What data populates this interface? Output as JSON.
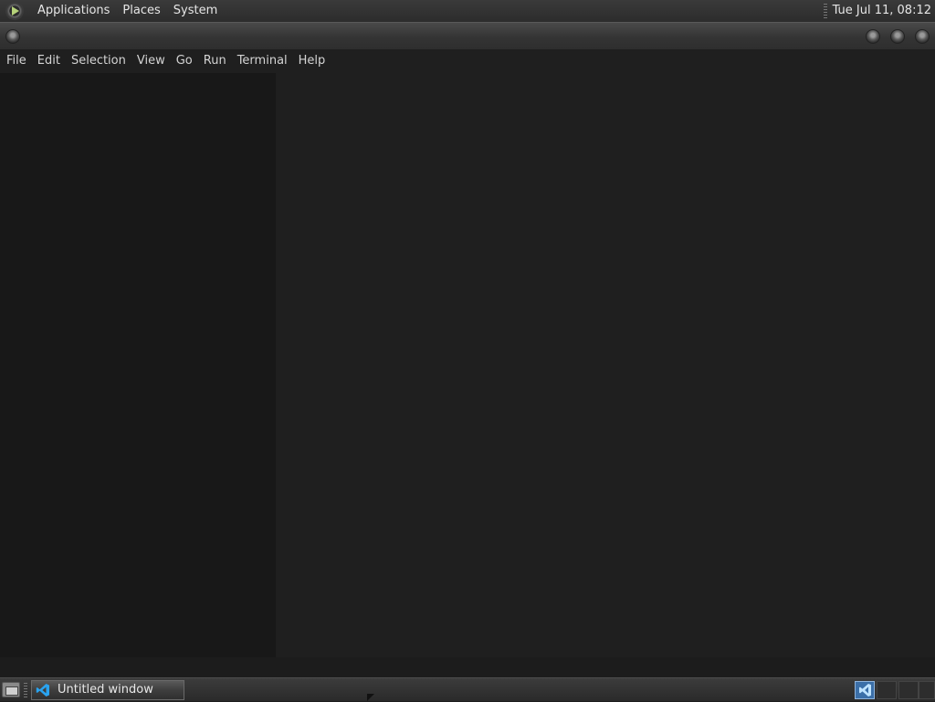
{
  "top_panel": {
    "menus": [
      "Applications",
      "Places",
      "System"
    ],
    "clock": "Tue Jul 11, 08:12"
  },
  "menubar": {
    "items": [
      "File",
      "Edit",
      "Selection",
      "View",
      "Go",
      "Run",
      "Terminal",
      "Help"
    ]
  },
  "taskbar": {
    "window_label": "Untitled window",
    "icons": [
      "show-desktop-icon",
      "vscode-icon"
    ]
  },
  "colors": {
    "sidebar": "#181818",
    "editor": "#1f1f1f",
    "workspace_active": "#3b6fa8"
  }
}
